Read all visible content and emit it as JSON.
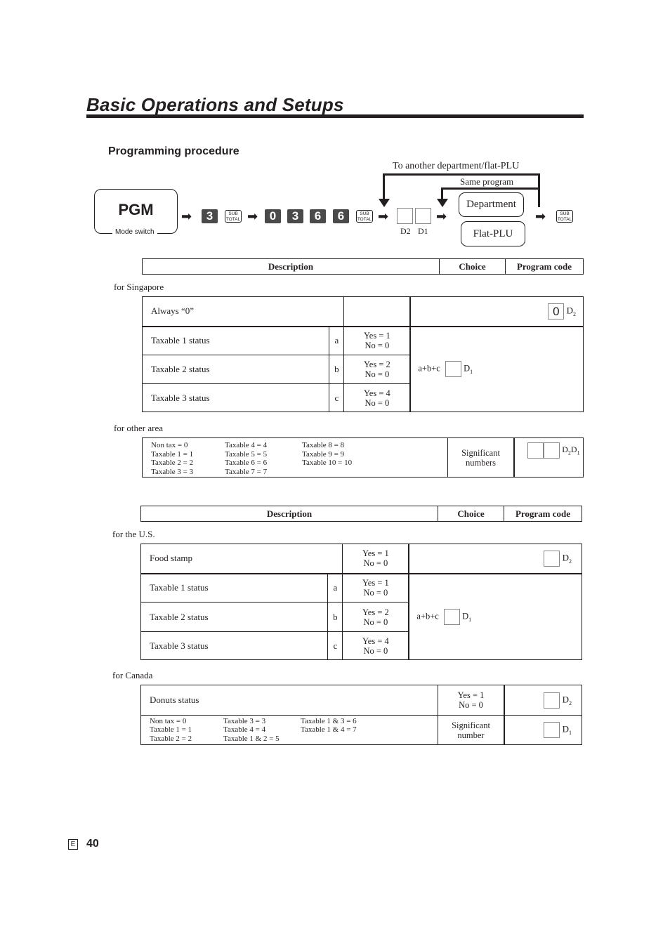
{
  "header": {
    "title": "Basic Operations and Setups"
  },
  "section_title": "Programming procedure",
  "procedure": {
    "mode_key": "PGM",
    "mode_caption": "Mode switch",
    "keys_step1": [
      "3"
    ],
    "subtotal_label_top": "SUB",
    "subtotal_label_bottom": "TOTAL",
    "keys_step2": [
      "0",
      "3",
      "6",
      "6"
    ],
    "digit_labels": [
      "D2",
      "D1"
    ],
    "loop_to_another": "To another department/flat-PLU",
    "loop_same": "Same program",
    "option_department": "Department",
    "option_flat_plu": "Flat-PLU"
  },
  "table1": {
    "headers": {
      "description": "Description",
      "choice": "Choice",
      "program_code": "Program code"
    },
    "singapore": {
      "caption": "for Singapore",
      "always_zero": {
        "label": "Always “0”",
        "code_value": "0",
        "digit": "D",
        "digit_sub": "2"
      },
      "rows": [
        {
          "label": "Taxable 1 status",
          "letter": "a",
          "yes": "Yes = 1",
          "no": "No  = 0"
        },
        {
          "label": "Taxable 2 status",
          "letter": "b",
          "yes": "Yes = 2",
          "no": "No  = 0"
        },
        {
          "label": "Taxable 3 status",
          "letter": "c",
          "yes": "Yes = 4",
          "no": "No  = 0"
        }
      ],
      "sum_label": "a+b+c",
      "sum_digit": "D",
      "sum_digit_sub": "1"
    },
    "other": {
      "caption": "for other area",
      "col1": [
        "Non tax = 0",
        "Taxable 1 = 1",
        "Taxable 2 = 2",
        "Taxable 3 = 3"
      ],
      "col2": [
        "Taxable 4 = 4",
        "Taxable 5 = 5",
        "Taxable 6 = 6",
        "Taxable 7 = 7"
      ],
      "col3": [
        "Taxable 8 = 8",
        "Taxable 9 = 9",
        "Taxable 10 = 10"
      ],
      "choice_line1": "Significant",
      "choice_line2": "numbers",
      "digits": "D2D1"
    }
  },
  "table2": {
    "headers": {
      "description": "Description",
      "choice": "Choice",
      "program_code": "Program code"
    },
    "us": {
      "caption": "for the U.S.",
      "food_stamp": {
        "label": "Food stamp",
        "yes": "Yes = 1",
        "no": "No  = 0",
        "digit": "D",
        "digit_sub": "2"
      },
      "rows": [
        {
          "label": "Taxable 1 status",
          "letter": "a",
          "yes": "Yes = 1",
          "no": "No  = 0"
        },
        {
          "label": "Taxable 2 status",
          "letter": "b",
          "yes": "Yes = 2",
          "no": "No  = 0"
        },
        {
          "label": "Taxable 3 status",
          "letter": "c",
          "yes": "Yes = 4",
          "no": "No  = 0"
        }
      ],
      "sum_label": "a+b+c",
      "sum_digit": "D",
      "sum_digit_sub": "1"
    },
    "canada": {
      "caption": "for Canada",
      "donuts": {
        "label": "Donuts status",
        "yes": "Yes = 1",
        "no": "No  = 0",
        "digit": "D",
        "digit_sub": "2"
      },
      "col1": [
        "Non tax = 0",
        "Taxable 1 = 1",
        "Taxable 2 = 2"
      ],
      "col2": [
        "Taxable 3 = 3",
        "Taxable 4 = 4",
        "Taxable 1 & 2 = 5"
      ],
      "col3": [
        "Taxable 1 & 3 = 6",
        "Taxable 1 & 4 = 7"
      ],
      "choice_line1": "Significant",
      "choice_line2": "number",
      "digit": "D",
      "digit_sub": "1"
    }
  },
  "footer": {
    "lang": "E",
    "page": "40"
  }
}
